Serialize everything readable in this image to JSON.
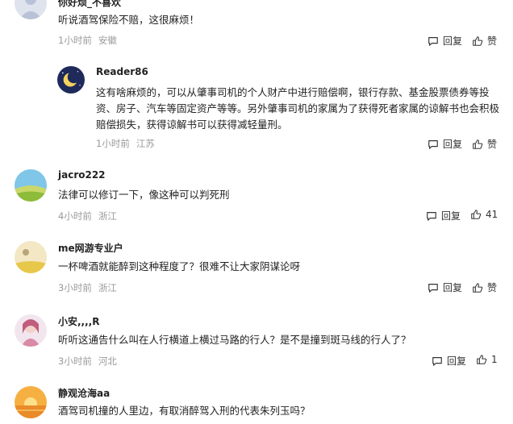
{
  "comments": [
    {
      "name": "你好烦_不喜欢",
      "text": "听说酒驾保险不赔，这很麻烦！",
      "time": "1小时前",
      "location": "安徽",
      "reply_label": "回复",
      "like_label": "赞"
    },
    {
      "name": "Reader86",
      "text": "这有啥麻烦的，可以从肇事司机的个人财产中进行赔偿啊，银行存款、基金股票债券等投资、房子、汽车等固定资产等等。另外肇事司机的家属为了获得死者家属的谅解书也会积极赔偿损失，获得谅解书可以获得减轻量刑。",
      "time": "1小时前",
      "location": "江苏",
      "reply_label": "回复",
      "like_label": "赞"
    },
    {
      "name": "jacro222",
      "text": "法律可以修订一下，像这种可以判死刑",
      "time": "4小时前",
      "location": "浙江",
      "reply_label": "回复",
      "like_label": "41"
    },
    {
      "name": "me网游专业户",
      "text": "一杯啤酒就能醉到这种程度了？很难不让大家阴谋论呀",
      "time": "3小时前",
      "location": "浙江",
      "reply_label": "回复",
      "like_label": "赞"
    },
    {
      "name": "小安,,,,R",
      "text": "听听这通告什么叫在人行横道上横过马路的行人？是不是撞到斑马线的行人了？",
      "time": "3小时前",
      "location": "河北",
      "reply_label": "回复",
      "like_label": "1"
    },
    {
      "name": "静观沧海aa",
      "text": "酒驾司机撞的人里边，有取消醉驾入刑的代表朱列玉吗？",
      "time": "",
      "location": "",
      "reply_label": "",
      "like_label": ""
    }
  ],
  "icons": {
    "reply": "speech-bubble-icon",
    "like": "thumbs-up-icon"
  }
}
